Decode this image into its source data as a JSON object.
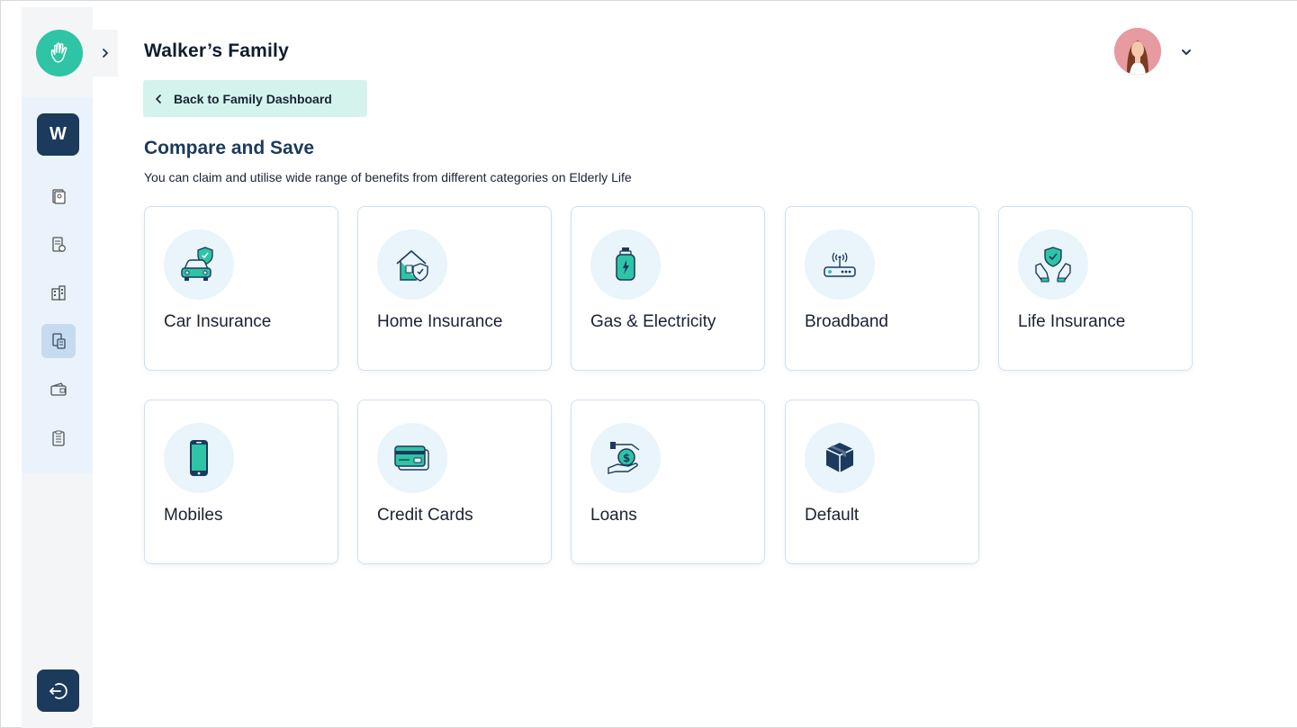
{
  "header": {
    "title": "Walker’s Family",
    "back_label": "Back to Family Dashboard"
  },
  "sidebar": {
    "workspace_initial": "W",
    "items": [
      {
        "icon": "document-stack-icon"
      },
      {
        "icon": "policy-document-icon"
      },
      {
        "icon": "building-icon"
      },
      {
        "icon": "compare-calculator-icon",
        "active": true
      },
      {
        "icon": "wallet-card-icon"
      },
      {
        "icon": "clipboard-checklist-icon"
      }
    ]
  },
  "main": {
    "section_title": "Compare and Save",
    "section_desc": "You can claim and utilise wide range of benefits from different categories on Elderly Life",
    "categories": [
      {
        "label": "Car Insurance",
        "icon": "car-shield-icon"
      },
      {
        "label": "Home Insurance",
        "icon": "home-shield-icon"
      },
      {
        "label": "Gas & Electricity",
        "icon": "gas-cylinder-icon"
      },
      {
        "label": "Broadband",
        "icon": "router-icon"
      },
      {
        "label": "Life Insurance",
        "icon": "hands-shield-icon"
      },
      {
        "label": "Mobiles",
        "icon": "mobile-phone-icon"
      },
      {
        "label": "Credit Cards",
        "icon": "credit-card-icon"
      },
      {
        "label": "Loans",
        "icon": "money-hand-icon"
      },
      {
        "label": "Default",
        "icon": "box-icon"
      }
    ]
  },
  "colors": {
    "accent": "#2ec4a5",
    "navy": "#1b3a5c",
    "card_border": "#cfe0ef",
    "back_button_bg": "#d4f3ec"
  }
}
